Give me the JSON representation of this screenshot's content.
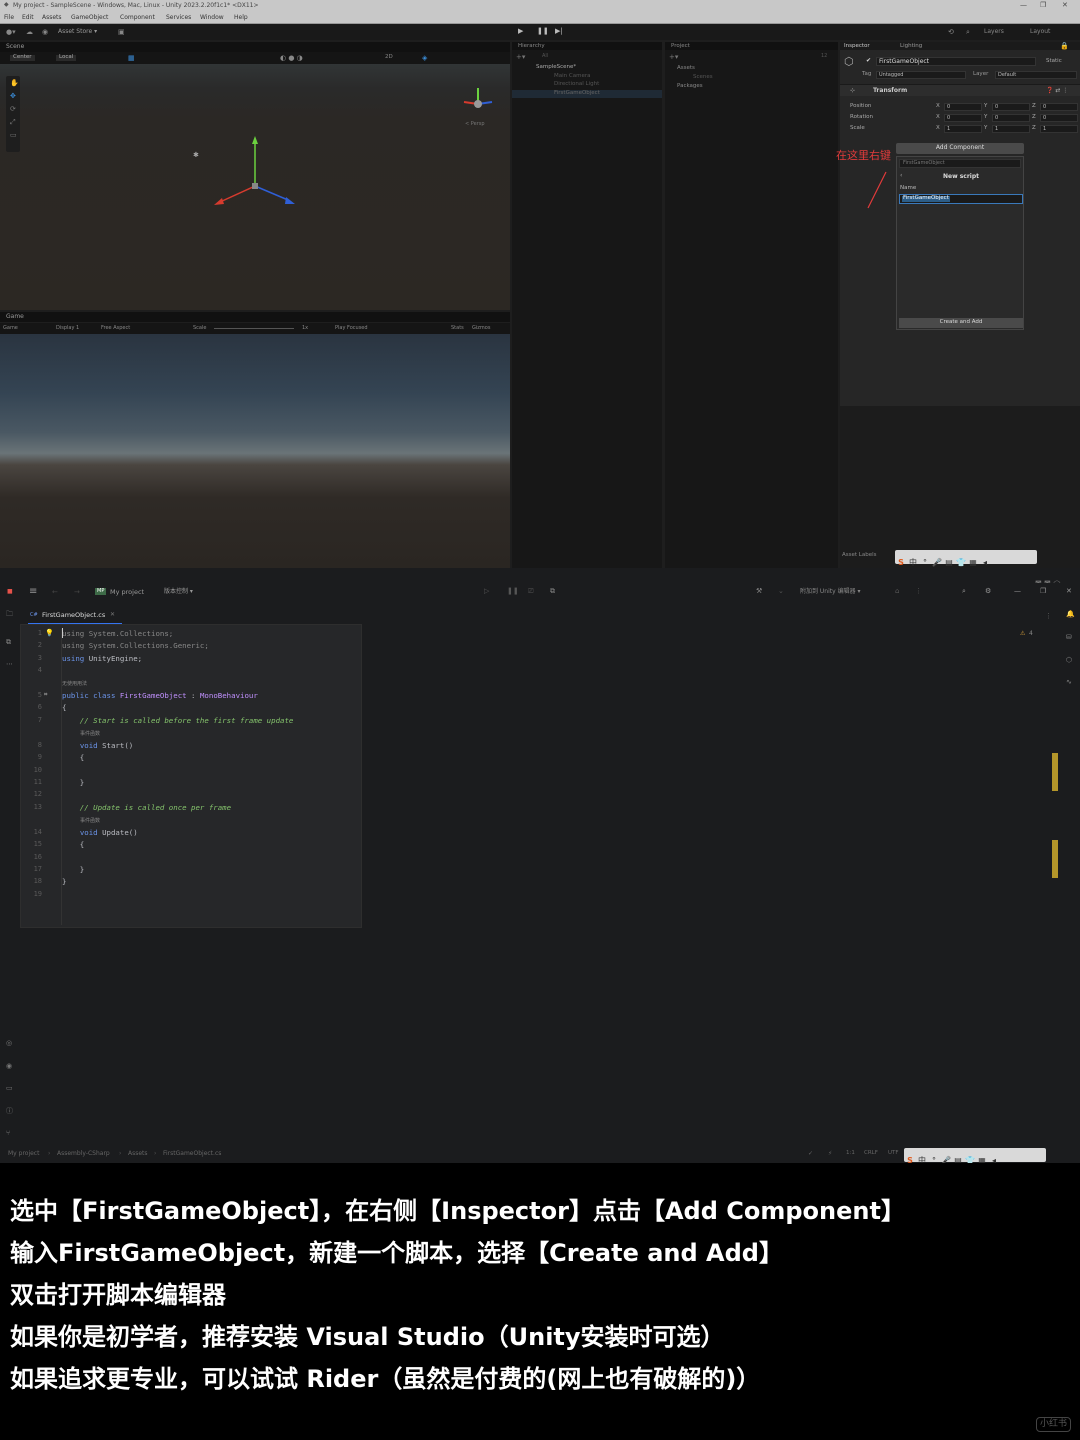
{
  "unity": {
    "window_title": "My project - SampleScene - Windows, Mac, Linux - Unity 2023.2.20f1c1* <DX11>",
    "menu": [
      "File",
      "Edit",
      "Assets",
      "GameObject",
      "Component",
      "Services",
      "Window",
      "Help"
    ],
    "toolbar": {
      "asset_store": "Asset Store ▾",
      "layers": "Layers",
      "layout": "Layout"
    },
    "scene": {
      "tab": "Scene",
      "center": "Center",
      "local": "Local",
      "persp": "< Persp",
      "two_d": "2D"
    },
    "game": {
      "tab": "Game",
      "mode": "Game",
      "display": "Display 1",
      "aspect": "Free Aspect",
      "scale_label": "Scale",
      "scale_value": "1x",
      "play_focused": "Play Focused",
      "stats": "Stats",
      "gizmos": "Gizmos"
    },
    "hierarchy": {
      "tab": "Hierarchy",
      "search_placeholder": "All",
      "scene": "SampleScene*",
      "items": [
        "Main Camera",
        "Directional Light",
        "FirstGameObject"
      ]
    },
    "project": {
      "tab": "Project",
      "items": [
        "Assets",
        "Scenes",
        "Packages"
      ],
      "count": "12"
    },
    "inspector": {
      "tab": "Inspector",
      "lighting_tab": "Lighting",
      "object_name": "FirstGameObject",
      "static_label": "Static",
      "tag_label": "Tag",
      "tag_value": "Untagged",
      "layer_label": "Layer",
      "layer_value": "Default",
      "transform": "Transform",
      "rows": [
        {
          "label": "Position",
          "x": "0",
          "y": "0",
          "z": "0"
        },
        {
          "label": "Rotation",
          "x": "0",
          "y": "0",
          "z": "0"
        },
        {
          "label": "Scale",
          "x": "1",
          "y": "1",
          "z": "1"
        }
      ],
      "add_component": "Add Component",
      "search_value": "FirstGameObject",
      "new_script": "New script",
      "name_label": "Name",
      "name_value": "FirstGameObject",
      "create_and_add": "Create and Add",
      "asset_labels": "Asset Labels"
    },
    "annotation": "在这里右键"
  },
  "rider": {
    "project": "My project",
    "vcs": "版本控制 ▾",
    "unity_attach": "附加到 Unity 编辑器 ▾",
    "file_tab": "FirstGameObject.cs",
    "warnings": "4",
    "hints": {
      "no_usages": "无使用用法",
      "event_fn": "事件函数"
    },
    "lines": [
      "1",
      "2",
      "3",
      "4",
      "5",
      "6",
      "7",
      "8",
      "9",
      "10",
      "11",
      "12",
      "13",
      "14",
      "15",
      "16",
      "17",
      "18",
      "19"
    ],
    "breadcrumb": [
      "My project",
      "Assembly-CSharp",
      "Assets",
      "FirstGameObject.cs"
    ],
    "status": {
      "pos": "1:1",
      "eol": "CRLF",
      "enc": "UTF"
    }
  },
  "caption": {
    "lines": [
      "选中【FirstGameObject】，在右侧【Inspector】点击【Add Component】",
      "输入FirstGameObject，新建一个脚本，选择【Create and Add】",
      "双击打开脚本编辑器",
      "如果你是初学者，推荐安装 Visual Studio（Unity安装时可选）",
      "如果追求更专业，可以试试 Rider（虽然是付费的(网上也有破解的)）"
    ]
  },
  "watermark": "小红书",
  "colors": {
    "selection": "#2c5d87",
    "annotation": "#e23b3b",
    "accent_blue": "#3574f0"
  }
}
